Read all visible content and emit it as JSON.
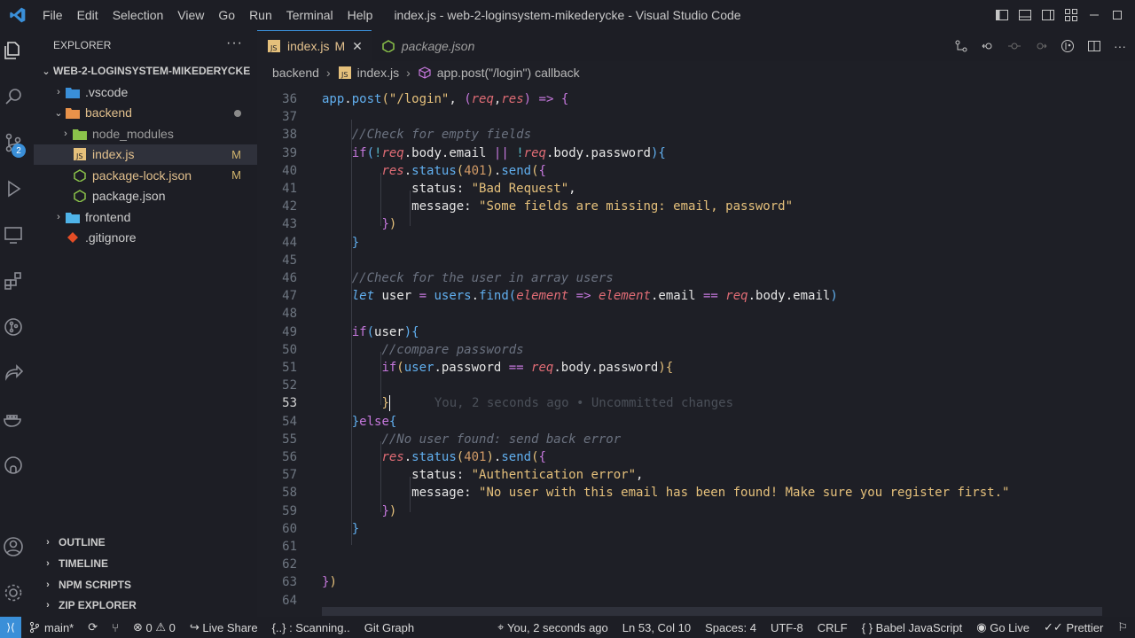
{
  "window": {
    "title": "index.js - web-2-loginsystem-mikederycke - Visual Studio Code",
    "menu": [
      "File",
      "Edit",
      "Selection",
      "View",
      "Go",
      "Run",
      "Terminal",
      "Help"
    ]
  },
  "activity_bar": {
    "items": [
      "explorer-icon",
      "search-icon",
      "source-control-icon",
      "run-debug-icon",
      "remote-explorer-icon",
      "extensions-icon",
      "git-graph-icon",
      "live-share-icon",
      "docker-icon",
      "github-icon",
      "accounts-icon",
      "manage-gear-icon"
    ],
    "source_control_badge": "2"
  },
  "sidebar": {
    "header": "EXPLORER",
    "more": "···",
    "root_folder": "WEB-2-LOGINSYSTEM-MIKEDERYCKE",
    "tree": [
      {
        "label": ".vscode",
        "status": ""
      },
      {
        "label": "backend",
        "status": "●"
      },
      {
        "label": "node_modules",
        "status": ""
      },
      {
        "label": "index.js",
        "status": "M"
      },
      {
        "label": "package-lock.json",
        "status": "M"
      },
      {
        "label": "package.json",
        "status": ""
      },
      {
        "label": "frontend",
        "status": ""
      },
      {
        "label": ".gitignore",
        "status": ""
      }
    ],
    "sections": [
      "OUTLINE",
      "TIMELINE",
      "NPM SCRIPTS",
      "ZIP EXPLORER"
    ]
  },
  "tabs": [
    {
      "label": "index.js",
      "modified": "M",
      "close": "✕"
    },
    {
      "label": "package.json"
    }
  ],
  "breadcrumb": {
    "folder": "backend",
    "file": "index.js",
    "symbol": "app.post(\"/login\") callback"
  },
  "editor": {
    "line_numbers": [
      "36",
      "37",
      "38",
      "39",
      "40",
      "41",
      "42",
      "43",
      "44",
      "45",
      "46",
      "47",
      "48",
      "49",
      "50",
      "51",
      "52",
      "53",
      "54",
      "55",
      "56",
      "57",
      "58",
      "59",
      "60",
      "61",
      "62",
      "63",
      "64"
    ],
    "current_line": "53",
    "blame": "You, 2 seconds ago • Uncommitted changes"
  },
  "statusbar": {
    "branch": "main*",
    "errors": "0",
    "warnings": "0",
    "live_share": "Live Share",
    "scanning": "{..} : Scanning..",
    "git_graph": "Git Graph",
    "blame": "You, 2 seconds ago",
    "cursor": "Ln 53, Col 10",
    "spaces": "Spaces: 4",
    "encoding": "UTF-8",
    "eol": "CRLF",
    "language": "Babel JavaScript",
    "go_live": "Go Live",
    "prettier": "Prettier"
  },
  "colors": {
    "accent": "#3a8fd8",
    "modified": "#e2c08d"
  }
}
